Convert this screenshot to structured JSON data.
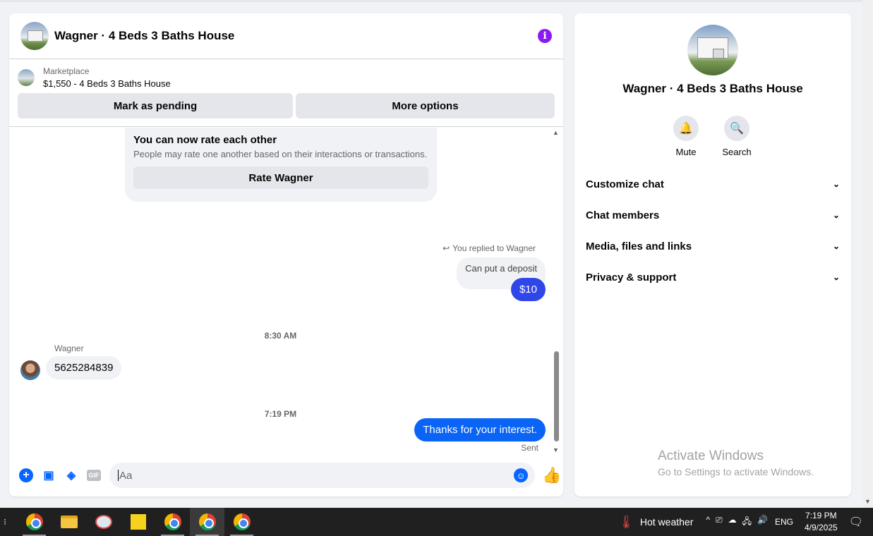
{
  "chat": {
    "title": "Wagner · 4 Beds 3 Baths House",
    "marketplace_source": "Marketplace",
    "listing": "$1,550 - 4 Beds 3 Baths House",
    "mark_pending": "Mark as pending",
    "more_options": "More options"
  },
  "rate": {
    "title": "You can now rate each other",
    "subtitle": "People may rate one another based on their interactions or transactions.",
    "button": "Rate Wagner"
  },
  "messages": {
    "replied_label": "You replied to Wagner",
    "quoted_text": "Can put a deposit",
    "reply_text": "$10",
    "time1": "8:30 AM",
    "sender": "Wagner",
    "incoming_text": "5625284839",
    "time2": "7:19 PM",
    "outgoing_text": "Thanks for your interest.",
    "status": "Sent"
  },
  "composer": {
    "placeholder": "Aa",
    "gif_label": "GIF"
  },
  "panel": {
    "name": "Wagner · 4 Beds 3 Baths House",
    "mute": "Mute",
    "search": "Search",
    "sections": [
      "Customize chat",
      "Chat members",
      "Media, files and links",
      "Privacy & support"
    ]
  },
  "watermark": {
    "line1": "Activate Windows",
    "line2": "Go to Settings to activate Windows."
  },
  "taskbar": {
    "weather": "Hot weather",
    "lang": "ENG",
    "time": "7:19 PM",
    "date": "4/9/2025"
  },
  "colors": {
    "messenger_blue": "#0a64f5",
    "info_purple": "#8b1af0"
  }
}
